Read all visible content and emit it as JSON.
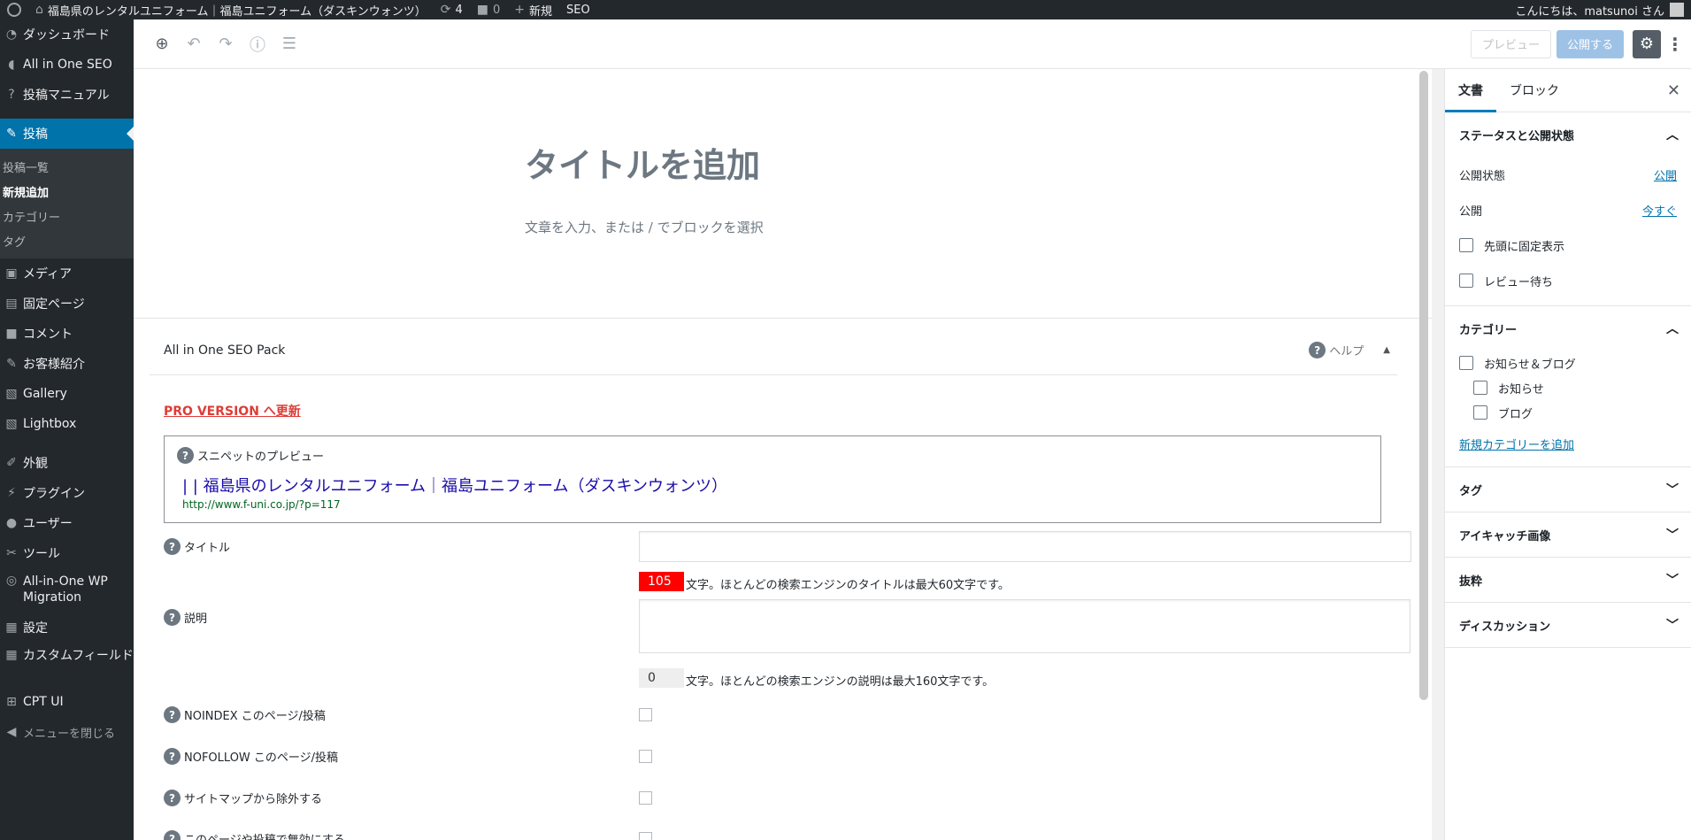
{
  "admin_bar": {
    "site_name": "福島県のレンタルユニフォーム｜福島ユニフォーム（ダスキンウォンツ）",
    "updates_count": "4",
    "comments_count": "0",
    "new_label": "新規",
    "seo_label": "SEO",
    "greeting": "こんにちは、matsunoi さん"
  },
  "menu": {
    "dashboard": "ダッシュボード",
    "aioseo": "All in One SEO",
    "manual": "投稿マニュアル",
    "posts": "投稿",
    "posts_sub": {
      "all": "投稿一覧",
      "add_new": "新規追加",
      "categories": "カテゴリー",
      "tags": "タグ"
    },
    "media": "メディア",
    "pages": "固定ページ",
    "comments": "コメント",
    "customers": "お客様紹介",
    "gallery": "Gallery",
    "lightbox": "Lightbox",
    "appearance": "外観",
    "plugins": "プラグイン",
    "users": "ユーザー",
    "tools": "ツール",
    "migration": "All-in-One WP Migration",
    "settings": "設定",
    "custom_fields": "カスタムフィールド",
    "cpt_ui": "CPT UI",
    "collapse": "メニューを閉じる"
  },
  "toolbar": {
    "preview": "プレビュー",
    "publish": "公開する"
  },
  "editor": {
    "title_placeholder": "タイトルを追加",
    "body_placeholder": "文章を入力、または / でブロックを選択"
  },
  "aioseo": {
    "panel_title": "All in One SEO Pack",
    "help": "ヘルプ",
    "pro_link": "PRO VERSION へ更新",
    "snippet_label": "スニペットのプレビュー",
    "snippet_title": "| | 福島県のレンタルユニフォーム｜福島ユニフォーム（ダスキンウォンツ）",
    "snippet_url": "http://www.f-uni.co.jp/?p=117",
    "title_label": "タイトル",
    "title_count": "105",
    "title_hint": "文字。ほとんどの検索エンジンのタイトルは最大60文字です。",
    "desc_label": "説明",
    "desc_count": "0",
    "desc_hint": "文字。ほとんどの検索エンジンの説明は最大160文字です。",
    "noindex_label": "NOINDEX このページ/投稿",
    "nofollow_label": "NOFOLLOW このページ/投稿",
    "sitemap_label": "サイトマップから除外する",
    "disable_label": "このページや投稿で無効にする"
  },
  "sidebar": {
    "tab_document": "文書",
    "tab_block": "ブロック",
    "status_title": "ステータスと公開状態",
    "visibility_label": "公開状態",
    "visibility_value": "公開",
    "publish_label": "公開",
    "publish_value": "今すぐ",
    "sticky_label": "先頭に固定表示",
    "pending_label": "レビュー待ち",
    "categories_title": "カテゴリー",
    "categories": [
      "お知らせ＆ブログ",
      "お知らせ",
      "ブログ"
    ],
    "add_category": "新規カテゴリーを追加",
    "tags_title": "タグ",
    "featured_title": "アイキャッチ画像",
    "excerpt_title": "抜粋",
    "discussion_title": "ディスカッション"
  }
}
